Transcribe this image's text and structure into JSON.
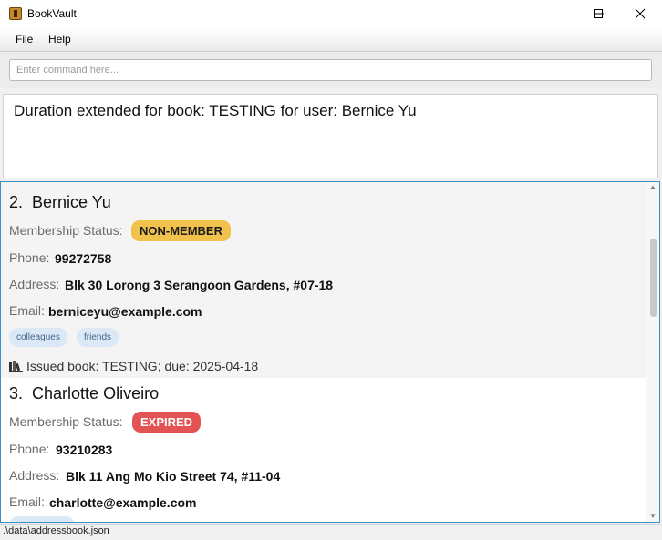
{
  "window": {
    "title": "BookVault",
    "controls": [
      "minimize-icon",
      "maximize-icon",
      "close-icon"
    ]
  },
  "menu": {
    "file": "File",
    "help": "Help"
  },
  "command": {
    "placeholder": "Enter command here...",
    "value": ""
  },
  "result": {
    "message": "Duration extended for book: TESTING for user: Bernice Yu"
  },
  "labels": {
    "membership": "Membership Status:",
    "phone": "Phone:",
    "address": "Address:",
    "email": "Email:"
  },
  "persons": [
    {
      "index": "2.",
      "name": "Bernice Yu",
      "status": "NON-MEMBER",
      "phone": "99272758",
      "address": "Blk 30 Lorong 3 Serangoon Gardens, #07-18",
      "email": "berniceyu@example.com",
      "tags": [
        "colleagues",
        "friends"
      ],
      "book": "Issued book: TESTING; due: 2025-04-18"
    },
    {
      "index": "3.",
      "name": "Charlotte Oliveiro",
      "status": "EXPIRED",
      "phone": "93210283",
      "address": "Blk 11 Ang Mo Kio Street 74, #11-04",
      "email": "charlotte@example.com"
    }
  ],
  "colors": {
    "non_member_badge": "#f0c14b",
    "expired_badge": "#e35353",
    "tag_bg": "#dbe8f5",
    "list_border": "#3c8fc7"
  },
  "status_bar": {
    "path": ".\\data\\addressbook.json"
  }
}
